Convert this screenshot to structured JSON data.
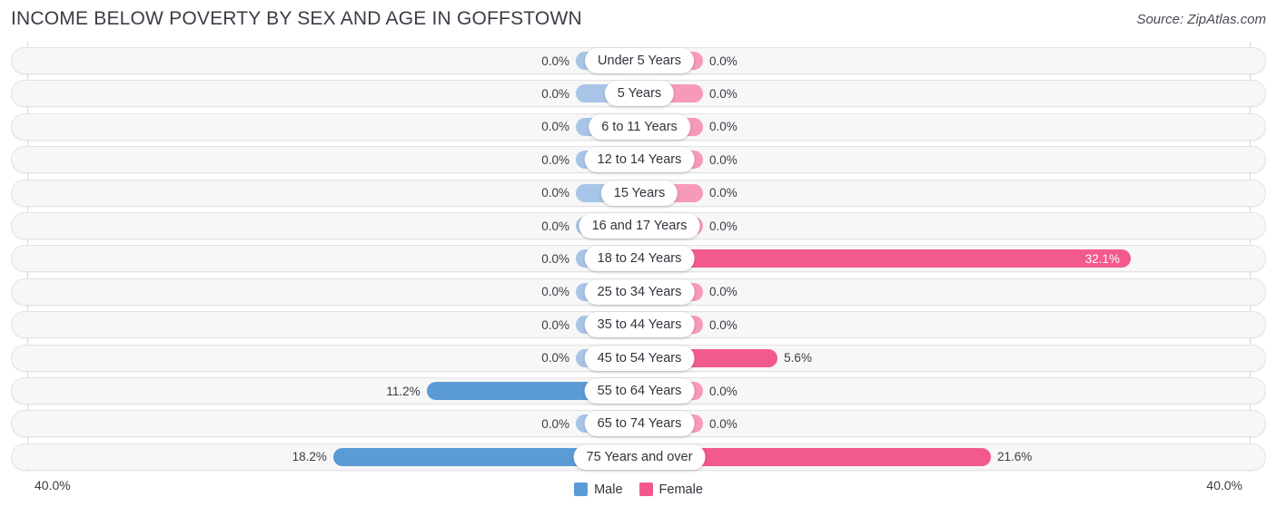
{
  "header": {
    "title": "INCOME BELOW POVERTY BY SEX AND AGE IN GOFFSTOWN",
    "source": "Source: ZipAtlas.com"
  },
  "axis": {
    "left_label": "40.0%",
    "right_label": "40.0%",
    "max": 40.0
  },
  "legend": {
    "male_label": "Male",
    "female_label": "Female",
    "male_color": "#5b9bd5",
    "female_color": "#f2598f"
  },
  "colors": {
    "male_zero": "#a8c5e8",
    "male_active": "#5b9bd5",
    "female_zero": "#f79ab8",
    "female_active": "#f2598f",
    "track": "#f7f7f7",
    "track_border": "#e3e3e6"
  },
  "chart_data": {
    "type": "bar",
    "title": "INCOME BELOW POVERTY BY SEX AND AGE IN GOFFSTOWN",
    "subtitle": "",
    "xlabel": "",
    "ylabel": "",
    "orientation": "horizontal-diverging",
    "grid": false,
    "legend_position": "bottom-center",
    "xlim": [
      40.0,
      40.0
    ],
    "axis_max": 40.0,
    "categories": [
      "Under 5 Years",
      "5 Years",
      "6 to 11 Years",
      "12 to 14 Years",
      "15 Years",
      "16 and 17 Years",
      "18 to 24 Years",
      "25 to 34 Years",
      "35 to 44 Years",
      "45 to 54 Years",
      "55 to 64 Years",
      "65 to 74 Years",
      "75 Years and over"
    ],
    "series": [
      {
        "name": "Male",
        "side": "left",
        "values": [
          0.0,
          0.0,
          0.0,
          0.0,
          0.0,
          0.0,
          0.0,
          0.0,
          0.0,
          0.0,
          11.2,
          0.0,
          18.2
        ],
        "labels": [
          "0.0%",
          "0.0%",
          "0.0%",
          "0.0%",
          "0.0%",
          "0.0%",
          "0.0%",
          "0.0%",
          "0.0%",
          "0.0%",
          "11.2%",
          "0.0%",
          "18.2%"
        ]
      },
      {
        "name": "Female",
        "side": "right",
        "values": [
          0.0,
          0.0,
          0.0,
          0.0,
          0.0,
          0.0,
          32.1,
          0.0,
          0.0,
          5.6,
          0.0,
          0.0,
          21.6
        ],
        "labels": [
          "0.0%",
          "0.0%",
          "0.0%",
          "0.0%",
          "0.0%",
          "0.0%",
          "32.1%",
          "0.0%",
          "0.0%",
          "5.6%",
          "0.0%",
          "0.0%",
          "21.6%"
        ]
      }
    ]
  }
}
